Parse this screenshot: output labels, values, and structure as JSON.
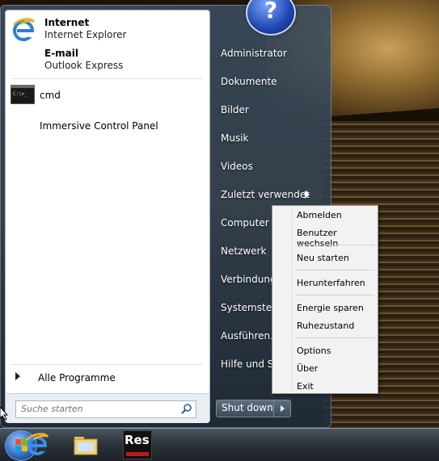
{
  "left_pane": {
    "pinned": [
      {
        "title": "Internet",
        "subtitle": "Internet Explorer",
        "icon": "internet-explorer-icon"
      },
      {
        "title": "E-mail",
        "subtitle": "Outlook Express",
        "icon": "email-icon"
      }
    ],
    "recent": [
      {
        "label": "cmd",
        "icon": "command-prompt-icon"
      },
      {
        "label": "Immersive Control Panel",
        "icon": ""
      }
    ],
    "all_programs": "Alle Programme",
    "search_placeholder": "Suche starten"
  },
  "right_pane": {
    "items": [
      {
        "label": "Administrator"
      },
      {
        "label": "Dokumente"
      },
      {
        "label": "Bilder"
      },
      {
        "label": "Musik"
      },
      {
        "label": "Videos"
      },
      {
        "label": "Zuletzt verwendet"
      },
      {
        "label": "Computer"
      },
      {
        "label": "Netzwerk"
      },
      {
        "label": "Verbindung"
      },
      {
        "label": "Systemsteu"
      },
      {
        "label": "Ausführen..."
      },
      {
        "label": "Hilfe und Su"
      }
    ],
    "help_glyph": "?",
    "shutdown_label": "Shut down"
  },
  "context_menu": {
    "items": [
      "Abmelden",
      "Benutzer wechseln",
      "Neu starten",
      "Herunterfahren",
      "Energie sparen",
      "Ruhezustand",
      "Options",
      "Über",
      "Exit"
    ]
  },
  "taskbar": {
    "res_label": "Res"
  }
}
